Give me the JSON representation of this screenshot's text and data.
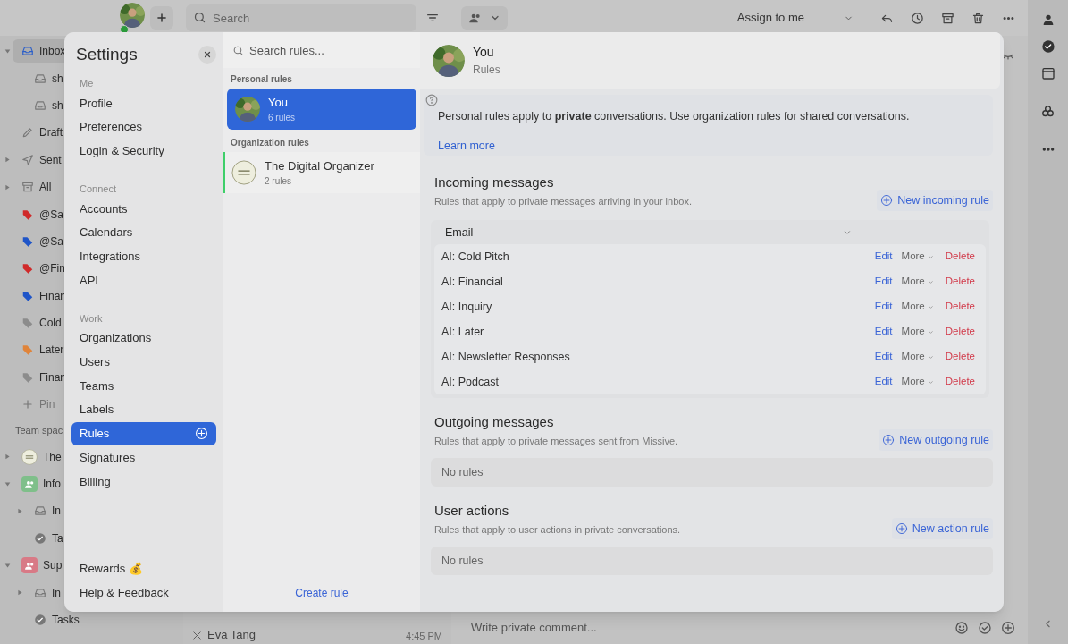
{
  "app": {
    "search": {
      "placeholder": "Search"
    },
    "assign": "Assign to me",
    "sidebar": [
      {
        "label": "Inbox",
        "kind": "inbox",
        "expanded": true,
        "selected": true
      },
      {
        "label": "sh",
        "kind": "subinbox"
      },
      {
        "label": "sh",
        "kind": "subinbox"
      },
      {
        "label": "Draft",
        "kind": "pencil"
      },
      {
        "label": "Sent",
        "kind": "send",
        "expanded": false
      },
      {
        "label": "All",
        "kind": "archive",
        "expanded": false
      },
      {
        "label": "@Sa",
        "kind": "tag",
        "color": "#d02a2a"
      },
      {
        "label": "@Sa",
        "kind": "tag",
        "color": "#1f55c8"
      },
      {
        "label": "@Fin",
        "kind": "tag",
        "color": "#d02a2a"
      },
      {
        "label": "Finan",
        "kind": "tag",
        "color": "#1f55c8"
      },
      {
        "label": "Cold",
        "kind": "tag",
        "color": "#8c8c8c"
      },
      {
        "label": "Later",
        "kind": "tag",
        "color": "#e0843a"
      },
      {
        "label": "Finan",
        "kind": "tag",
        "color": "#8c8c8c"
      },
      {
        "label": "Pin",
        "kind": "pin"
      },
      {
        "label": "Team spac",
        "kind": "heading"
      },
      {
        "label": "The",
        "kind": "org",
        "expanded": false
      },
      {
        "label": "Info",
        "kind": "team",
        "color": "#7fbf8a",
        "expanded": true
      },
      {
        "label": "In",
        "kind": "subinbox",
        "expanded": false
      },
      {
        "label": "Ta",
        "kind": "subtasks"
      },
      {
        "label": "Sup",
        "kind": "team",
        "color": "#d87a86",
        "expanded": true
      },
      {
        "label": "In",
        "kind": "subinbox",
        "expanded": false
      },
      {
        "label": "Tasks",
        "kind": "subtasks"
      }
    ],
    "conversation": {
      "sender": "Eva Tang",
      "time": "4:45 PM"
    },
    "comment": {
      "placeholder": "Write private comment..."
    }
  },
  "settings": {
    "title": "Settings",
    "nav": [
      {
        "heading": "Me",
        "items": [
          {
            "label": "Profile",
            "selected": false
          },
          {
            "label": "Preferences",
            "selected": false
          },
          {
            "label": "Login & Security",
            "selected": false
          }
        ]
      },
      {
        "heading": "Connect",
        "items": [
          {
            "label": "Accounts",
            "selected": false
          },
          {
            "label": "Calendars",
            "selected": false
          },
          {
            "label": "Integrations",
            "selected": false
          },
          {
            "label": "API",
            "selected": false
          }
        ]
      },
      {
        "heading": "Work",
        "items": [
          {
            "label": "Organizations",
            "selected": false
          },
          {
            "label": "Users",
            "selected": false
          },
          {
            "label": "Teams",
            "selected": false
          },
          {
            "label": "Labels",
            "selected": false
          },
          {
            "label": "Rules",
            "selected": true
          },
          {
            "label": "Signatures",
            "selected": false
          },
          {
            "label": "Billing",
            "selected": false
          }
        ]
      }
    ],
    "footer": [
      {
        "label": "Rewards 💰"
      },
      {
        "label": "Help & Feedback"
      }
    ],
    "rules_search": {
      "placeholder": "Search rules..."
    },
    "rule_groups": [
      {
        "heading": "Personal rules",
        "owners": [
          {
            "name": "You",
            "count": "6 rules",
            "kind": "person",
            "selected": true
          }
        ]
      },
      {
        "heading": "Organization rules",
        "owners": [
          {
            "name": "The Digital Organizer",
            "count": "2 rules",
            "kind": "org",
            "selected": false,
            "color": "#3fcf6a"
          }
        ]
      }
    ],
    "create_rule": "Create rule",
    "header": {
      "name": "You",
      "subtitle": "Rules"
    },
    "info": {
      "text": "Personal rules apply to **private** conversations. Use organization rules for shared conversations.",
      "link": "Learn more"
    },
    "sections": [
      {
        "title": "Incoming messages",
        "description": "Rules that apply to private messages arriving in your inbox.",
        "action": "New incoming rule",
        "groups": [
          {
            "name": "Email",
            "expanded": true,
            "rules": [
              {
                "name": "AI: Cold Pitch",
                "edit": "Edit",
                "more": "More",
                "delete": "Delete"
              },
              {
                "name": "AI: Financial",
                "edit": "Edit",
                "more": "More",
                "delete": "Delete"
              },
              {
                "name": "AI: Inquiry",
                "edit": "Edit",
                "more": "More",
                "delete": "Delete"
              },
              {
                "name": "AI: Later",
                "edit": "Edit",
                "more": "More",
                "delete": "Delete"
              },
              {
                "name": "AI: Newsletter Responses",
                "edit": "Edit",
                "more": "More",
                "delete": "Delete"
              },
              {
                "name": "AI: Podcast",
                "edit": "Edit",
                "more": "More",
                "delete": "Delete"
              }
            ]
          }
        ]
      },
      {
        "title": "Outgoing messages",
        "description": "Rules that apply to private messages sent from Missive.",
        "action": "New outgoing rule",
        "empty": "No rules"
      },
      {
        "title": "User actions",
        "description": "Rules that apply to user actions in private conversations.",
        "action": "New action rule",
        "empty": "No rules"
      }
    ]
  }
}
